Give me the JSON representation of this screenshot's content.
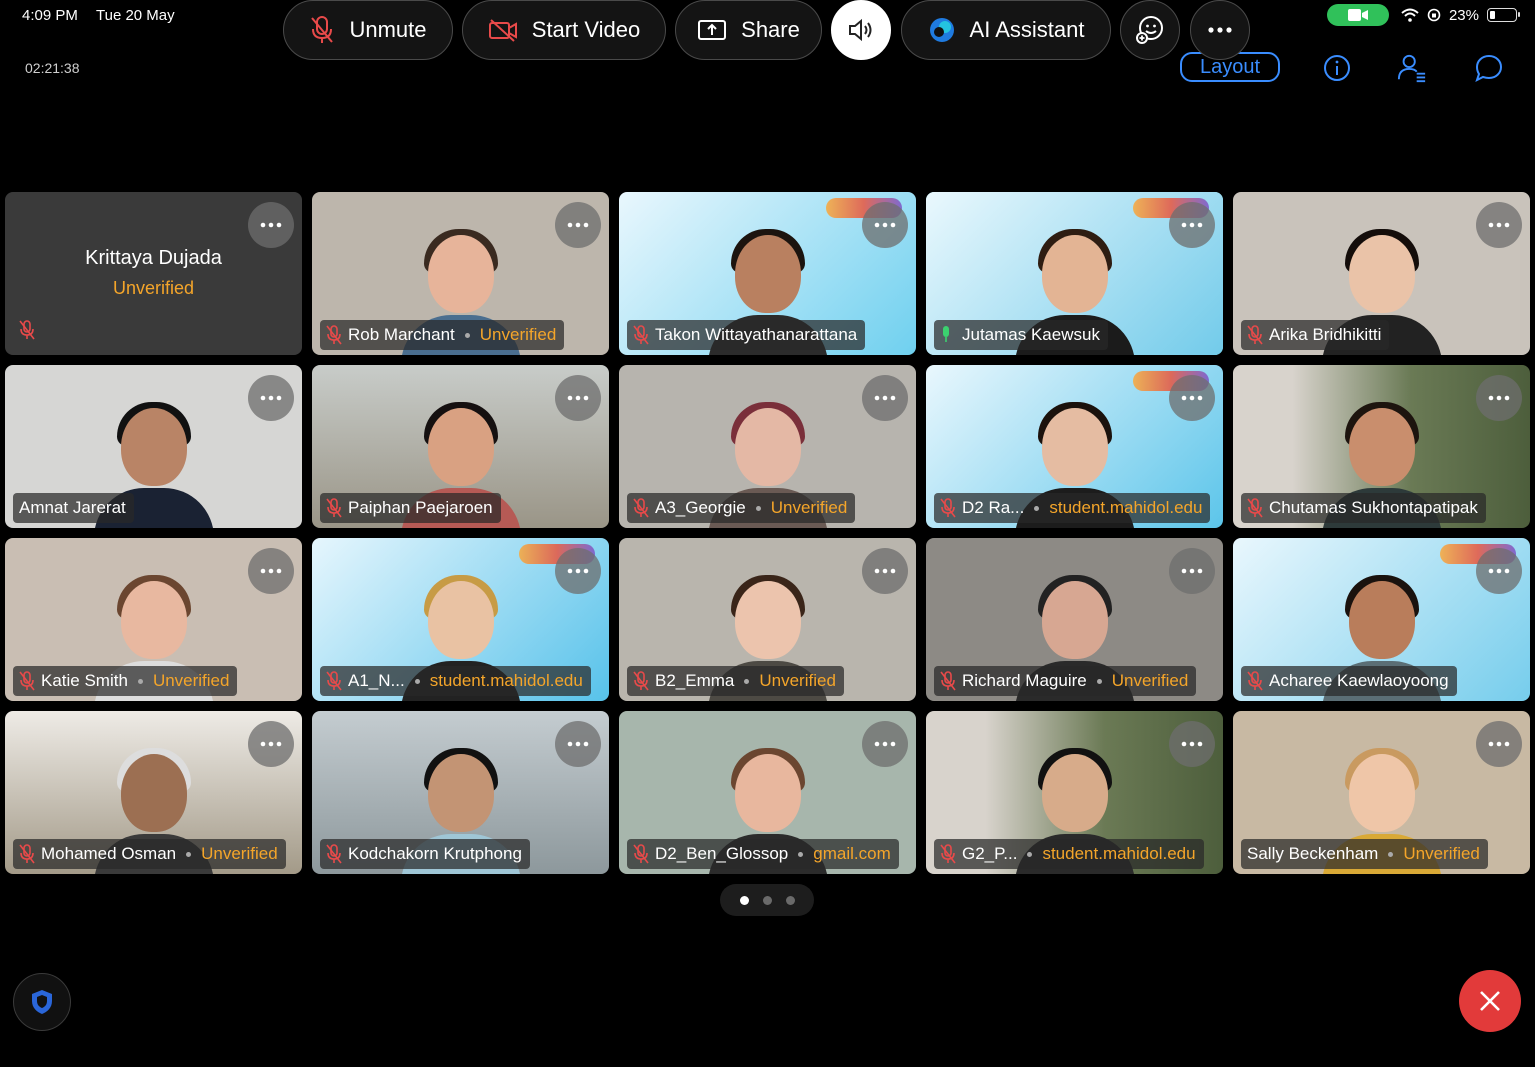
{
  "status_bar": {
    "time": "4:09 PM",
    "date": "Tue 20 May",
    "battery": "23%",
    "battery_level": 0.23
  },
  "meeting": {
    "elapsed": "02:21:38",
    "layout_label": "Layout"
  },
  "participants": [
    {
      "name": "Krittaya Dujada",
      "status": "Unverified",
      "video": false,
      "muted": true
    },
    {
      "name": "Rob Marchant",
      "status": "Unverified",
      "muted": true,
      "bg": "#bdb6ac",
      "skin": "#e7b49a",
      "hair": "#3a2a20",
      "shirt": "#4a6e8f"
    },
    {
      "name": "Takon Wittayathanarattana",
      "status": "",
      "muted": true,
      "bg": "linear-gradient(135deg,#e9f7fd,#6fd0ef)",
      "skin": "#b98060",
      "hair": "#1c140f",
      "shirt": "#2b2b2b",
      "logo": true
    },
    {
      "name": "Jutamas Kaewsuk",
      "status": "",
      "muted": false,
      "active": true,
      "bg": "linear-gradient(135deg,#eaf8fd,#72cbea)",
      "skin": "#e3b494",
      "hair": "#2e1d12",
      "shirt": "#1b1b1b",
      "logo": true
    },
    {
      "name": "Arika Bridhikitti",
      "status": "",
      "muted": true,
      "bg": "#c9c3bb",
      "skin": "#eac3a8",
      "hair": "#140d0a",
      "shirt": "#222"
    },
    {
      "name": "Amnat Jarerat",
      "status": "",
      "muted": false,
      "bg": "#d6d6d4",
      "skin": "#b98466",
      "hair": "#111",
      "shirt": "#1a2233"
    },
    {
      "name": "Paiphan Paejaroen",
      "status": "",
      "muted": true,
      "bg": "linear-gradient(180deg,#c8ccc9,#9a9587)",
      "skin": "#d9a182",
      "hair": "#151010",
      "shirt": "#b65a55"
    },
    {
      "name": "A3_Georgie",
      "status": "Unverified",
      "muted": true,
      "bg": "#b7b4ae",
      "skin": "#e4b8a5",
      "hair": "#7a2f3a",
      "shirt": "#6a5a54"
    },
    {
      "name": "D2 Ra...",
      "status": "student.mahidol.edu",
      "muted": true,
      "bg": "linear-gradient(135deg,#e9f7fd,#5cc5ea)",
      "skin": "#e5bca2",
      "hair": "#1b120d",
      "shirt": "#1c1c1c",
      "logo": true
    },
    {
      "name": "Chutamas Sukhontapatipak",
      "status": "",
      "muted": true,
      "bg": "linear-gradient(90deg,#d8d3cc 20%,#6a7a55 60%,#4d5e3c)",
      "skin": "#c98e6d",
      "hair": "#1d140e",
      "shirt": "#2d3a3a"
    },
    {
      "name": "Katie Smith",
      "status": "Unverified",
      "muted": true,
      "bg": "#c9beb3",
      "skin": "#e8b8a0",
      "hair": "#6b4630",
      "shirt": "#ddd"
    },
    {
      "name": "A1_N...",
      "status": "student.mahidol.edu",
      "muted": true,
      "bg": "linear-gradient(135deg,#e6f6fd,#57c2ea)",
      "skin": "#e9c2a3",
      "hair": "#c79b45",
      "shirt": "#222",
      "logo": true
    },
    {
      "name": "B2_Emma",
      "status": "Unverified",
      "muted": true,
      "bg": "#b9b5ad",
      "skin": "#ecc4ad",
      "hair": "#3a2519",
      "shirt": "#4d4a44"
    },
    {
      "name": "Richard Maguire",
      "status": "Unverified",
      "muted": true,
      "bg": "#8d8a85",
      "skin": "#d7a792",
      "hair": "#222",
      "shirt": "#2a2a2a"
    },
    {
      "name": "Acharee Kaewlaoyoong",
      "status": "",
      "muted": true,
      "bg": "linear-gradient(135deg,#e9f7fd,#76cdec)",
      "skin": "#b97d5b",
      "hair": "#1a120e",
      "shirt": "#5b6e75",
      "logo": true
    },
    {
      "name": "Mohamed Osman",
      "status": "Unverified",
      "muted": true,
      "bg": "linear-gradient(180deg,#eeebe6,#a39a88)",
      "skin": "#9c6f52",
      "hair": "#ddd",
      "shirt": "#3a3a3a"
    },
    {
      "name": "Kodchakorn Krutphong",
      "status": "",
      "muted": true,
      "bg": "linear-gradient(180deg,#c4ccd0,#8d989c)",
      "skin": "#c39474",
      "hair": "#111",
      "shirt": "#9fc6d6"
    },
    {
      "name": "D2_Ben_Glossop",
      "status": "gmail.com",
      "muted": true,
      "bg": "#a7b6ac",
      "skin": "#e8b79e",
      "hair": "#6b4630",
      "shirt": "#2b2b2b"
    },
    {
      "name": "G2_P...",
      "status": "student.mahidol.edu",
      "muted": true,
      "bg": "linear-gradient(90deg,#d8d3cc 20%,#6b7a55 60%,#4d5e3c)",
      "skin": "#d7ab8a",
      "hair": "#111",
      "shirt": "#2a2a2a"
    },
    {
      "name": "Sally Beckenham",
      "status": "Unverified",
      "muted": false,
      "bg": "#c8b9a3",
      "skin": "#efc6a8",
      "hair": "#c99a60",
      "shirt": "#d9a936"
    }
  ],
  "pager": {
    "pages": 3,
    "current": 1
  },
  "toolbar": {
    "unmute_label": "Unmute",
    "start_video_label": "Start Video",
    "share_label": "Share",
    "ai_assistant_label": "AI Assistant"
  },
  "colors": {
    "accent": "#3a8dff",
    "unverified": "#f4a52a",
    "end": "#e23a3a",
    "active_border": "#5fd0d6"
  }
}
